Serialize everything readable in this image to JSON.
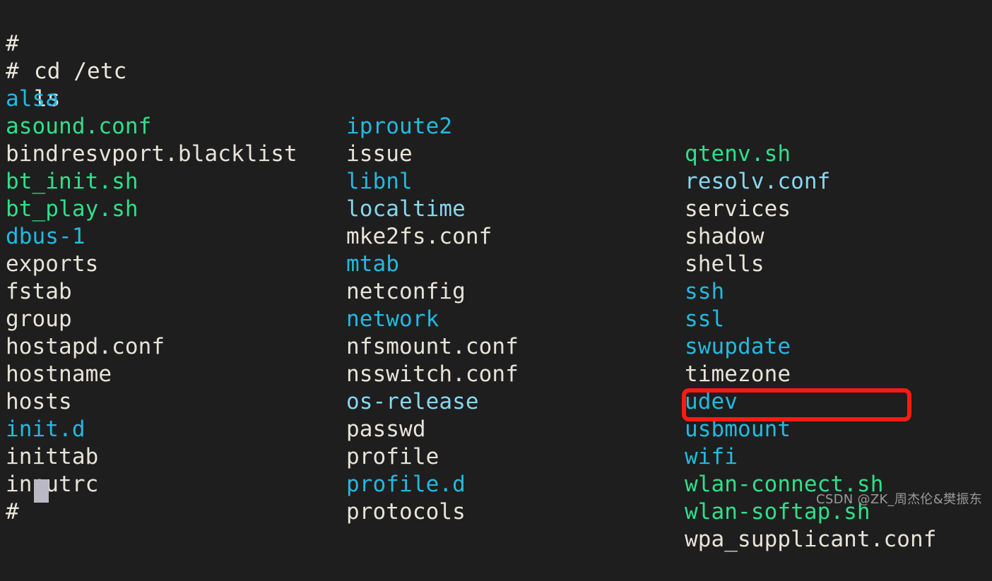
{
  "terminal": {
    "background_color": "#1e1e1e",
    "prompt_symbol": "#",
    "commands": [
      {
        "prompt": "# ",
        "text": "cd /etc"
      },
      {
        "prompt": "# ",
        "text": "ls"
      }
    ],
    "final_prompt": "# ",
    "cursor": {
      "shape": "block",
      "color": "#b9b8c4"
    }
  },
  "colors": {
    "plain": "#e8e3d8",
    "directory": "#23b9e0",
    "executable": "#2ee08a",
    "symlink": "#86d7ef",
    "highlight": "#fc1b12"
  },
  "listing": {
    "columns": [
      {
        "entries": [
          {
            "name": "alsa",
            "kind": "directory"
          },
          {
            "name": "asound.conf",
            "kind": "executable"
          },
          {
            "name": "bindresvport.blacklist",
            "kind": "plain"
          },
          {
            "name": "bt_init.sh",
            "kind": "executable"
          },
          {
            "name": "bt_play.sh",
            "kind": "executable"
          },
          {
            "name": "dbus-1",
            "kind": "directory"
          },
          {
            "name": "exports",
            "kind": "plain"
          },
          {
            "name": "fstab",
            "kind": "plain"
          },
          {
            "name": "group",
            "kind": "plain"
          },
          {
            "name": "hostapd.conf",
            "kind": "plain"
          },
          {
            "name": "hostname",
            "kind": "plain"
          },
          {
            "name": "hosts",
            "kind": "plain"
          },
          {
            "name": "init.d",
            "kind": "directory"
          },
          {
            "name": "inittab",
            "kind": "plain"
          },
          {
            "name": "inputrc",
            "kind": "plain"
          }
        ]
      },
      {
        "entries": [
          {
            "name": "iproute2",
            "kind": "directory"
          },
          {
            "name": "issue",
            "kind": "plain"
          },
          {
            "name": "libnl",
            "kind": "directory"
          },
          {
            "name": "localtime",
            "kind": "symlink"
          },
          {
            "name": "mke2fs.conf",
            "kind": "plain"
          },
          {
            "name": "mtab",
            "kind": "directory"
          },
          {
            "name": "netconfig",
            "kind": "plain"
          },
          {
            "name": "network",
            "kind": "directory"
          },
          {
            "name": "nfsmount.conf",
            "kind": "plain"
          },
          {
            "name": "nsswitch.conf",
            "kind": "plain"
          },
          {
            "name": "os-release",
            "kind": "symlink"
          },
          {
            "name": "passwd",
            "kind": "plain"
          },
          {
            "name": "profile",
            "kind": "plain"
          },
          {
            "name": "profile.d",
            "kind": "directory"
          },
          {
            "name": "protocols",
            "kind": "plain"
          }
        ]
      },
      {
        "entries": [
          {
            "name": "qtenv.sh",
            "kind": "executable"
          },
          {
            "name": "resolv.conf",
            "kind": "symlink"
          },
          {
            "name": "services",
            "kind": "plain"
          },
          {
            "name": "shadow",
            "kind": "plain"
          },
          {
            "name": "shells",
            "kind": "plain"
          },
          {
            "name": "ssh",
            "kind": "directory"
          },
          {
            "name": "ssl",
            "kind": "directory"
          },
          {
            "name": "swupdate",
            "kind": "directory"
          },
          {
            "name": "timezone",
            "kind": "plain"
          },
          {
            "name": "udev",
            "kind": "directory"
          },
          {
            "name": "usbmount",
            "kind": "directory"
          },
          {
            "name": "wifi",
            "kind": "directory"
          },
          {
            "name": "wlan-connect.sh",
            "kind": "executable",
            "highlighted": true
          },
          {
            "name": "wlan-softap.sh",
            "kind": "executable"
          },
          {
            "name": "wpa_supplicant.conf",
            "kind": "plain"
          }
        ]
      }
    ]
  },
  "annotation": {
    "target": "wlan-connect.sh",
    "border_color": "#fc1b12"
  },
  "watermark": {
    "text": "CSDN @ZK_周杰伦&樊振东"
  }
}
